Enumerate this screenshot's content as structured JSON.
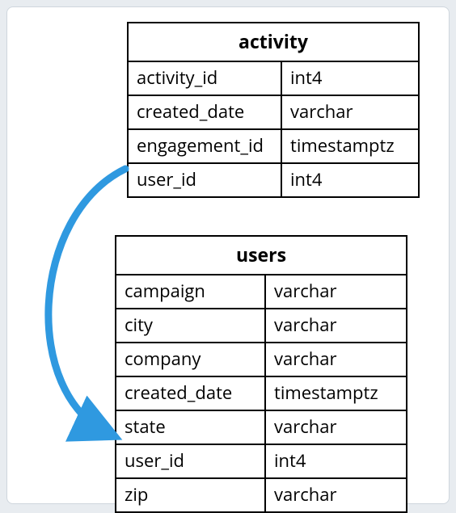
{
  "tables": {
    "activity": {
      "title": "activity",
      "rows": [
        {
          "name": "activity_id",
          "type": "int4"
        },
        {
          "name": "created_date",
          "type": "varchar"
        },
        {
          "name": "engagement_id",
          "type": "timestamptz"
        },
        {
          "name": "user_id",
          "type": "int4"
        }
      ]
    },
    "users": {
      "title": "users",
      "rows": [
        {
          "name": "campaign",
          "type": "varchar"
        },
        {
          "name": "city",
          "type": "varchar"
        },
        {
          "name": "company",
          "type": "varchar"
        },
        {
          "name": "created_date",
          "type": "timestamptz"
        },
        {
          "name": "state",
          "type": "varchar"
        },
        {
          "name": "user_id",
          "type": "int4"
        },
        {
          "name": "zip",
          "type": "varchar"
        }
      ]
    }
  },
  "relationship": {
    "from": "activity.user_id",
    "to": "users.user_id",
    "arrow_color": "#2f99e0"
  }
}
